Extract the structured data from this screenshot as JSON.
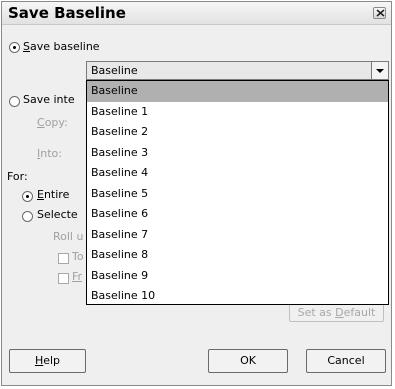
{
  "dialog": {
    "title": "Save Baseline"
  },
  "save_baseline": {
    "label_accel": "S",
    "label_rest": "ave baseline",
    "selected_value": "Baseline"
  },
  "save_interim": {
    "label": "Save inte"
  },
  "copy_label_accel": "C",
  "copy_label_rest": "opy:",
  "into_label_accel": "I",
  "into_label_rest": "nto:",
  "for": {
    "label": "For:",
    "entire_accel": "E",
    "entire_rest": "ntire",
    "selected": "Selecte",
    "rollup": "Roll u",
    "to_partial": "To",
    "from_partial": "Fr"
  },
  "baseline_options": [
    "Baseline",
    "Baseline 1",
    "Baseline 2",
    "Baseline 3",
    "Baseline 4",
    "Baseline 5",
    "Baseline 6",
    "Baseline 7",
    "Baseline 8",
    "Baseline 9",
    "Baseline 10"
  ],
  "buttons": {
    "set_as_default_pre": "Set as ",
    "set_as_default_accel": "D",
    "set_as_default_post": "efault",
    "help_accel": "H",
    "help_rest": "elp",
    "ok": "OK",
    "cancel": "Cancel"
  }
}
